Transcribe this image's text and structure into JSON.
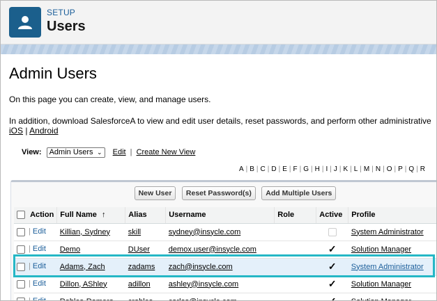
{
  "header": {
    "eyebrow": "SETUP",
    "title": "Users",
    "icon": "user-icon"
  },
  "page": {
    "title": "Admin Users",
    "intro": "On this page you can create, view, and manage users.",
    "intro2": "In addition, download SalesforceA to view and edit user details, reset passwords, and perform other administrative",
    "ios_link": "iOS",
    "link_sep": "|",
    "android_link": "Android"
  },
  "view": {
    "label": "View:",
    "selected": "Admin Users",
    "edit_link": "Edit",
    "sep": "|",
    "create_link": "Create New View"
  },
  "alphabet": [
    "A",
    "B",
    "C",
    "D",
    "E",
    "F",
    "G",
    "H",
    "I",
    "J",
    "K",
    "L",
    "M",
    "N",
    "O",
    "P",
    "Q",
    "R"
  ],
  "buttons": {
    "new_user": "New User",
    "reset_password": "Reset Password(s)",
    "add_multiple": "Add Multiple Users"
  },
  "table": {
    "columns": {
      "action": "Action",
      "full_name": "Full Name",
      "sort_indicator": "↑",
      "alias": "Alias",
      "username": "Username",
      "role": "Role",
      "active": "Active",
      "profile": "Profile"
    },
    "edit_label": "Edit",
    "rows": [
      {
        "full_name": "Killian, Sydney",
        "alias": "skill",
        "username": "sydney@insycle.com",
        "role": "",
        "active": false,
        "profile": "System Administrator"
      },
      {
        "full_name": "Demo",
        "alias": "DUser",
        "username": "demox.user@insycle.com",
        "role": "",
        "active": true,
        "profile": "Solution Manager"
      },
      {
        "full_name": "Adams, Zach",
        "alias": "zadams",
        "username": "zach@insycle.com",
        "role": "",
        "active": true,
        "profile": "System Administrator"
      },
      {
        "full_name": "Dillon, AShley",
        "alias": "adillon",
        "username": "ashley@insycle.com",
        "role": "",
        "active": true,
        "profile": "Solution Manager"
      },
      {
        "full_name": "Robles-Romero",
        "alias": "crobles",
        "username": "carlos@insycle.com",
        "role": "",
        "active": true,
        "profile": "Solution Manager"
      }
    ]
  },
  "colors": {
    "accent": "#1b5f8c",
    "highlight_border": "#25b7c6",
    "highlight_row": "#e4f0fa"
  }
}
